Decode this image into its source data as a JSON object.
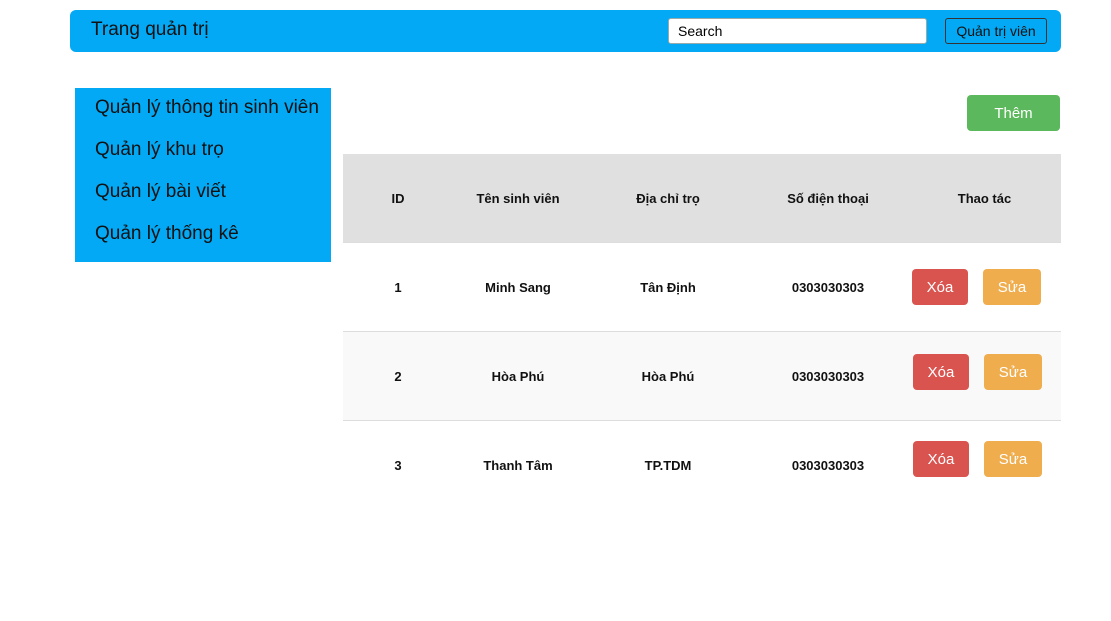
{
  "header": {
    "brand": "Trang quản trị",
    "search_value": "Search",
    "admin_label": "Quản trị viên"
  },
  "sidebar": {
    "items": [
      {
        "label": "Quản lý thông tin sinh viên"
      },
      {
        "label": "Quản lý khu trọ"
      },
      {
        "label": "Quản lý bài viết"
      },
      {
        "label": "Quản lý thống kê"
      }
    ]
  },
  "main": {
    "add_label": "Thêm"
  },
  "table": {
    "headers": [
      "ID",
      "Tên sinh viên",
      "Địa chỉ trọ",
      "Số điện thoại",
      "Thao tác"
    ],
    "rows": [
      {
        "id": "1",
        "name": "Minh Sang",
        "address": "Tân Định",
        "phone": "0303030303"
      },
      {
        "id": "2",
        "name": "Hòa Phú",
        "address": "Hòa Phú",
        "phone": "0303030303"
      },
      {
        "id": "3",
        "name": "Thanh Tâm",
        "address": "TP.TDM",
        "phone": "0303030303"
      }
    ],
    "delete_label": "Xóa",
    "edit_label": "Sửa"
  },
  "colors": {
    "primary": "#03a9f4",
    "success": "#5cb85c",
    "danger": "#d9534f",
    "warning": "#f0ad4e",
    "header_bg": "#e0e0e0"
  }
}
